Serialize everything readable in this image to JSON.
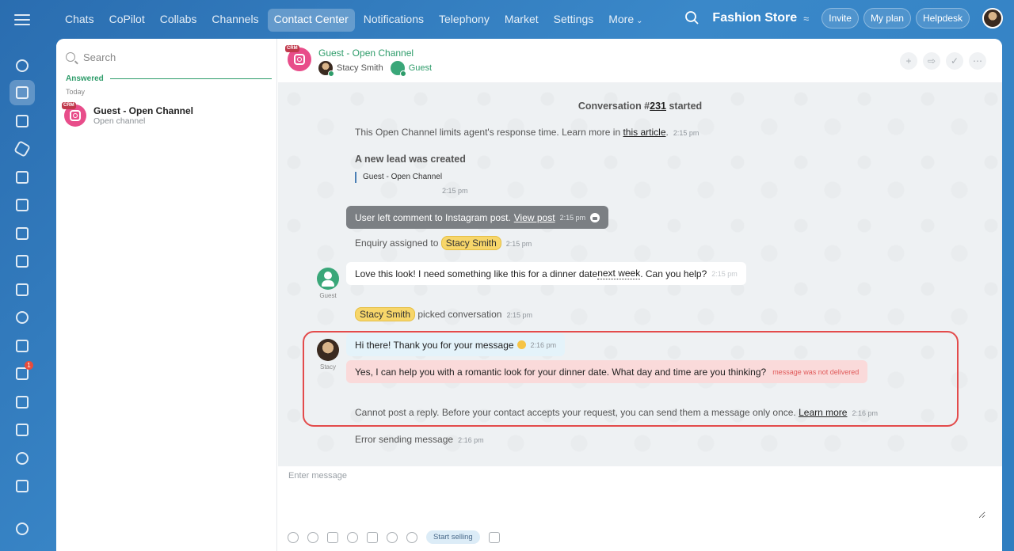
{
  "nav": {
    "items": [
      "Chats",
      "CoPilot",
      "Collabs",
      "Channels",
      "Contact Center",
      "Notifications",
      "Telephony",
      "Market",
      "Settings",
      "More"
    ],
    "active_index": 4
  },
  "header": {
    "store_title": "Fashion Store",
    "invite_label": "Invite",
    "plan_label": "My plan",
    "helpdesk_label": "Helpdesk"
  },
  "rail": {
    "badge_count": "1"
  },
  "chatlist": {
    "search_placeholder": "Search",
    "section_title": "Answered",
    "section_sub": "Today",
    "item": {
      "crm": "CRM",
      "title": "Guest - Open Channel",
      "subtitle": "Open channel"
    }
  },
  "conversation": {
    "title": "Guest - Open Channel",
    "crm": "CRM",
    "member_agent": "Stacy Smith",
    "member_guest": "Guest",
    "started_prefix": "Conversation #",
    "started_number": "231",
    "started_suffix": " started",
    "notice_text": "This Open Channel limits agent's response time. Learn more in ",
    "notice_link": "this article",
    "notice_tail": ".",
    "notice_time": "2:15 pm",
    "lead_title": "A new lead was created",
    "lead_quote": "Guest - Open Channel",
    "lead_time": "2:15 pm",
    "ig_text": "User left comment to Instagram post.",
    "ig_link": "View post",
    "ig_time": "2:15 pm",
    "assigned_text": "Enquiry assigned to ",
    "assigned_name": "Stacy Smith",
    "assigned_time": "2:15 pm",
    "guest_label": "Guest",
    "guest_msg_a": "Love this look! I need something like this for a dinner date ",
    "guest_msg_link": "next week",
    "guest_msg_b": ". Can you help?",
    "guest_msg_time": "2:15 pm",
    "picked_name": "Stacy Smith",
    "picked_text": " picked conversation",
    "picked_time": "2:15 pm",
    "agent_label": "Stacy",
    "agent_msg1": "Hi there! Thank you for your message",
    "agent_msg1_time": "2:16 pm",
    "agent_msg2": "Yes, I can help you with a romantic look for your dinner date. What day and time are you thinking?",
    "agent_msg2_status": "message was not delivered",
    "error_text": "Cannot post a reply. Before your contact accepts your request, you can send them a message only once. ",
    "error_link": "Learn more",
    "error_time": "2:16 pm",
    "send_error_text": "Error sending message",
    "send_error_time": "2:16 pm"
  },
  "composer": {
    "placeholder": "Enter message",
    "start_selling_label": "Start selling"
  },
  "colors": {
    "accent_green": "#2e9c6a",
    "highlight_red": "#e34b4b",
    "name_tag": "#f7d66a"
  }
}
